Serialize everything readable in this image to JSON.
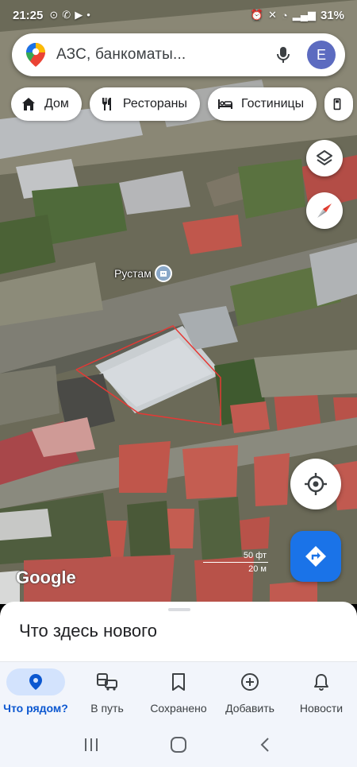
{
  "status_bar": {
    "time": "21:25",
    "battery": "31%"
  },
  "search": {
    "placeholder": "АЗС, банкоматы...",
    "avatar_letter": "E"
  },
  "chips": [
    {
      "label": "Дом",
      "icon": "home-icon"
    },
    {
      "label": "Рестораны",
      "icon": "restaurant-icon"
    },
    {
      "label": "Гостиницы",
      "icon": "hotel-icon"
    },
    {
      "label": "",
      "icon": "gas-station-icon"
    }
  ],
  "map": {
    "place_label": "Рустам",
    "logo": "Google",
    "scale_top": "50 фт",
    "scale_bottom": "20 м"
  },
  "sheet": {
    "title": "Что здесь нового"
  },
  "nav": [
    {
      "label": "Что рядом?",
      "icon": "location-pin-icon",
      "active": true
    },
    {
      "label": "В путь",
      "icon": "commute-icon",
      "active": false
    },
    {
      "label": "Сохранено",
      "icon": "bookmark-icon",
      "active": false
    },
    {
      "label": "Добавить",
      "icon": "add-circle-icon",
      "active": false
    },
    {
      "label": "Новости",
      "icon": "bell-icon",
      "active": false
    }
  ],
  "colors": {
    "accent": "#1a73e8",
    "active_nav_bg": "#d3e3fd",
    "active_nav_text": "#0b57d0",
    "avatar": "#5c6bc0",
    "boundary": "#e53935"
  }
}
